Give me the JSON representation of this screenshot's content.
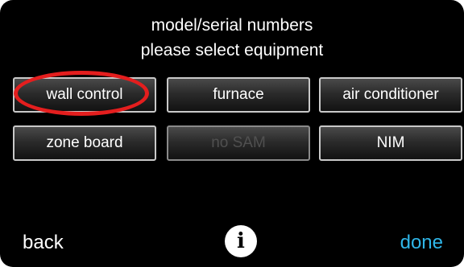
{
  "header": {
    "title": "model/serial numbers",
    "subtitle": "please select equipment"
  },
  "equipment_buttons": [
    {
      "label": "wall control",
      "enabled": true,
      "highlighted": true
    },
    {
      "label": "furnace",
      "enabled": true
    },
    {
      "label": "air conditioner",
      "enabled": true
    },
    {
      "label": "zone board",
      "enabled": true
    },
    {
      "label": "no SAM",
      "enabled": false
    },
    {
      "label": "NIM",
      "enabled": true
    }
  ],
  "footer": {
    "back_label": "back",
    "info_label": "i",
    "done_label": "done"
  },
  "colors": {
    "background": "#000000",
    "done_accent": "#2fb6e8",
    "highlight_ring": "#e41e1e"
  },
  "icons": {
    "info": "info-icon"
  }
}
